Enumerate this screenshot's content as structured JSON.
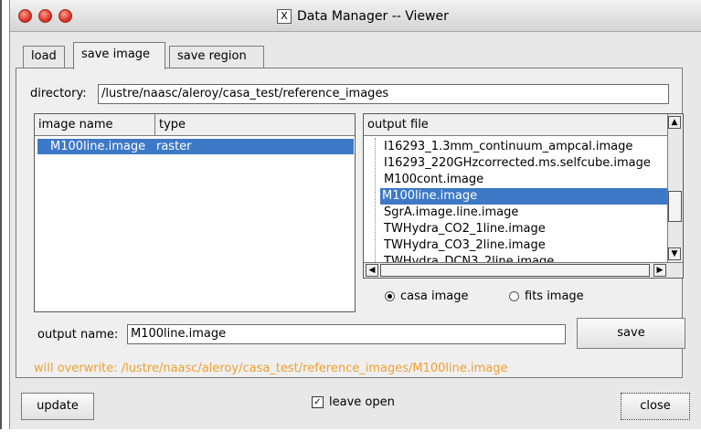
{
  "window": {
    "title": "Data Manager -- Viewer",
    "title_icon": "X"
  },
  "tabs": [
    {
      "label": "load",
      "active": false
    },
    {
      "label": "save image",
      "active": true
    },
    {
      "label": "save region",
      "active": false
    }
  ],
  "directory": {
    "label": "directory:",
    "value": "/lustre/naasc/aleroy/casa_test/reference_images"
  },
  "image_table": {
    "col_name": "image name",
    "col_type": "type",
    "rows": [
      {
        "name": "M100line.image",
        "type": "raster"
      }
    ]
  },
  "output_files": {
    "header": "output file",
    "items": [
      "I16293_1.3mm_continuum_ampcal.image",
      "I16293_220GHzcorrected.ms.selfcube.image",
      "M100cont.image",
      "M100line.image",
      "SgrA.image.line.image",
      "TWHydra_CO2_1line.image",
      "TWHydra_CO3_2line.image",
      "TWHydra_DCN3_2line.image"
    ],
    "selected": "M100line.image"
  },
  "format": {
    "casa_label": "casa image",
    "fits_label": "fits image",
    "selected": "casa image"
  },
  "output_name": {
    "label": "output name:",
    "value": "M100line.image"
  },
  "buttons": {
    "save": "save",
    "update": "update",
    "close": "close"
  },
  "warning": "will overwrite: /lustre/naasc/aleroy/casa_test/reference_images/M100line.image",
  "leave_open": {
    "label": "leave open",
    "checked": true,
    "mark": "✓"
  },
  "colors": {
    "selection": "#3d79c6",
    "warning": "#f0a030"
  }
}
